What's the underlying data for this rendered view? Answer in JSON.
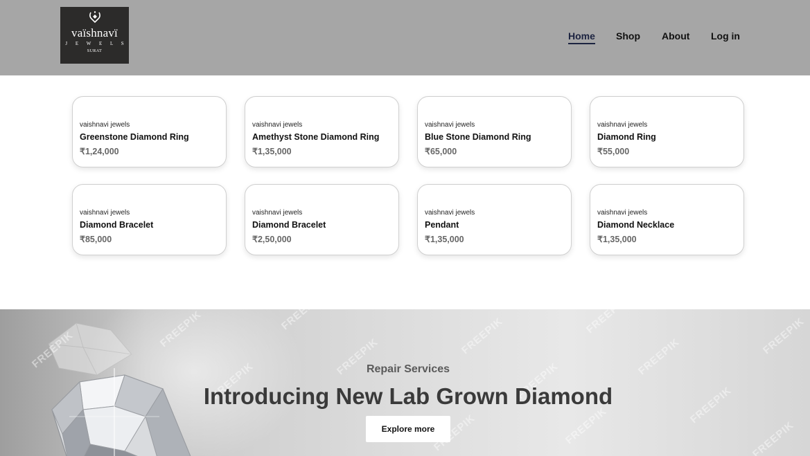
{
  "brand": {
    "name": "vaïshnavï",
    "tagline": "J E W E L S",
    "city": "SURAT",
    "logo_icon": "diamond-crest-icon"
  },
  "nav": {
    "items": [
      {
        "label": "Home",
        "active": true
      },
      {
        "label": "Shop",
        "active": false
      },
      {
        "label": "About",
        "active": false
      },
      {
        "label": "Log in",
        "active": false
      }
    ],
    "active_color": "#1c2340"
  },
  "products": [
    {
      "brand": "vaishnavi jewels",
      "title": "Greenstone Diamond Ring",
      "price": "₹1,24,000"
    },
    {
      "brand": "vaishnavi jewels",
      "title": "Amethyst Stone Diamond Ring",
      "price": "₹1,35,000"
    },
    {
      "brand": "vaishnavi jewels",
      "title": "Blue Stone Diamond Ring",
      "price": "₹65,000"
    },
    {
      "brand": "vaishnavi jewels",
      "title": "Diamond Ring",
      "price": "₹55,000"
    },
    {
      "brand": "vaishnavi jewels",
      "title": "Diamond Bracelet",
      "price": "₹85,000"
    },
    {
      "brand": "vaishnavi jewels",
      "title": "Diamond Bracelet",
      "price": "₹2,50,000"
    },
    {
      "brand": "vaishnavi jewels",
      "title": "Pendant",
      "price": "₹1,35,000"
    },
    {
      "brand": "vaishnavi jewels",
      "title": "Diamond Necklace",
      "price": "₹1,35,000"
    }
  ],
  "hero": {
    "subtitle": "Repair Services",
    "title": "Introducing New Lab Grown Diamond",
    "button_label": "Explore more",
    "watermark": "FREEPIK"
  },
  "colors": {
    "header_bg": "#a6a6a6",
    "logo_bg": "#2c2b2a",
    "price_text": "#666666"
  }
}
